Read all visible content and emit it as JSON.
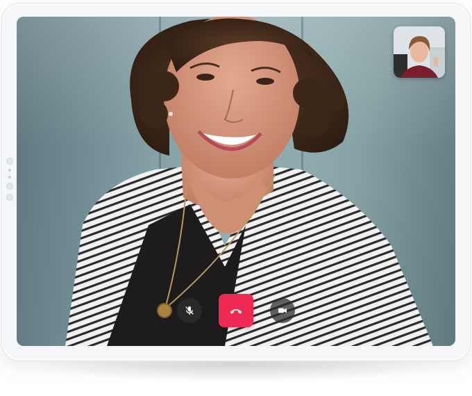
{
  "call": {
    "remote_participant": "remote-video",
    "self_view": "self-video-thumbnail"
  },
  "controls": {
    "mute_icon": "microphone-muted-icon",
    "end_call_icon": "phone-hangup-icon",
    "video_icon": "video-camera-icon"
  },
  "colors": {
    "end_call": "#ee2a53",
    "control_bg": "#2d2d30",
    "device_frame": "#f4f6f8"
  }
}
